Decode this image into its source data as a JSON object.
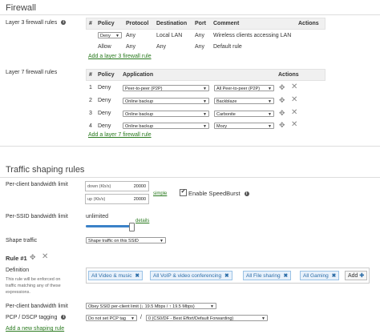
{
  "page_title": "Firewall",
  "l3": {
    "label": "Layer 3 firewall rules",
    "headers": [
      "#",
      "Policy",
      "Protocol",
      "Destination",
      "Port",
      "Comment",
      "Actions"
    ],
    "rows": [
      {
        "policy": "Deny",
        "protocol": "Any",
        "destination": "Local LAN",
        "port": "Any",
        "comment": "Wireless clients accessing LAN"
      },
      {
        "policy": "Allow",
        "protocol": "Any",
        "destination": "Any",
        "port": "Any",
        "comment": "Default rule"
      }
    ],
    "add_link": "Add a layer 3 firewall rule"
  },
  "l7": {
    "label": "Layer 7 firewall rules",
    "headers": [
      "#",
      "Policy",
      "Application",
      "Actions"
    ],
    "rows": [
      {
        "num": "1",
        "policy": "Deny",
        "app": "Peer-to-peer (P2P)",
        "value": "All Peer-to-peer (P2P)"
      },
      {
        "num": "2",
        "policy": "Deny",
        "app": "Online backup",
        "value": "Backblaze"
      },
      {
        "num": "3",
        "policy": "Deny",
        "app": "Online backup",
        "value": "Carbonite"
      },
      {
        "num": "4",
        "policy": "Deny",
        "app": "Online backup",
        "value": "Mozy"
      }
    ],
    "add_link": "Add a layer 7 firewall rule"
  },
  "shaping": {
    "title": "Traffic shaping rules",
    "per_client_label": "Per-client bandwidth limit",
    "down_label": "down (Kb/s)",
    "down_value": "20000",
    "up_label": "up (Kb/s)",
    "up_value": "20000",
    "simple_link": "simple",
    "speedburst_label": "Enable SpeedBurst",
    "per_ssid_label": "Per-SSID bandwidth limit",
    "per_ssid_value": "unlimited",
    "details_link": "details",
    "slider_level": 0.95,
    "shape_traffic_label": "Shape traffic",
    "shape_traffic_value": "Shape traffic on this SSID"
  },
  "rule": {
    "title": "Rule #1",
    "definition_label": "Definition",
    "definition_help": [
      "This rule will be enforced on",
      "traffic matching any of these",
      "expressions."
    ],
    "tags": [
      "All Video & music",
      "All VoIP & video conferencing",
      "All File sharing",
      "All Gaming"
    ],
    "add_label": "Add",
    "bw_label": "Per-client bandwidth limit",
    "bw_value": "Obey SSID per-client limit (↓ 19.5 Mbps / ↑ 19.5 Mbps)",
    "pcp_label": "PCP / DSCP tagging",
    "pcp_value": "Do not set PCP tag",
    "slash": "/",
    "dscp_value": "0 (CS0/DF - Best Effort/Default Forwarding)",
    "add_link": "Add a new shaping rule"
  },
  "colors": {
    "link": "#2a7a1f",
    "tag_bg": "#e8f1fb",
    "tag_border": "#9bc3e6",
    "slider": "#3b82c8"
  }
}
